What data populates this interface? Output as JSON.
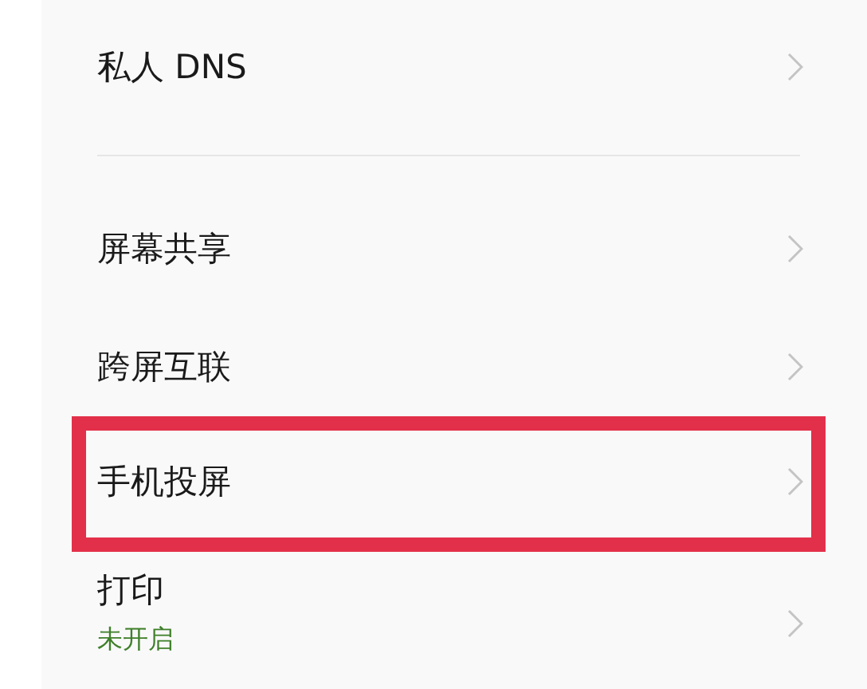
{
  "groups": [
    {
      "items": [
        {
          "label": "私人 DNS",
          "highlighted": false
        }
      ]
    },
    {
      "items": [
        {
          "label": "屏幕共享",
          "highlighted": false
        },
        {
          "label": "跨屏互联",
          "highlighted": false
        },
        {
          "label": "手机投屏",
          "highlighted": true
        },
        {
          "label": "打印",
          "subtitle": "未开启",
          "highlighted": false
        }
      ]
    }
  ]
}
